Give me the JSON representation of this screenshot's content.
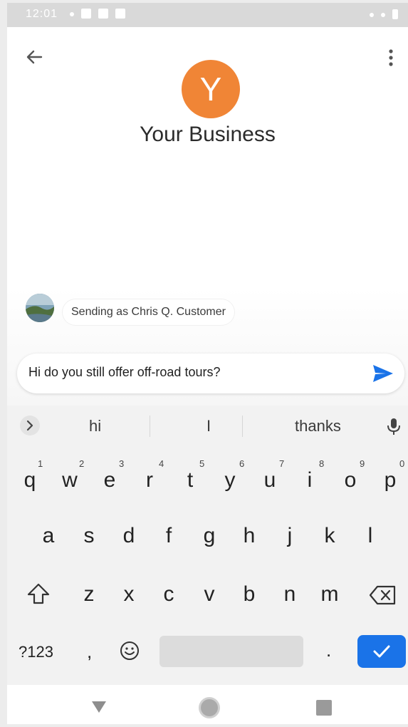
{
  "status_bar": {
    "time": "12:01"
  },
  "header": {
    "business_initial": "Y",
    "business_name": "Your Business",
    "avatar_color": "#f08536"
  },
  "chat": {
    "sending_as": "Sending as Chris Q. Customer"
  },
  "composer": {
    "message_text": "Hi do you still offer off-road tours?",
    "send_color": "#1a73e8"
  },
  "keyboard": {
    "suggestions": [
      "hi",
      "I",
      "thanks"
    ],
    "row1": [
      {
        "letter": "q",
        "num": "1"
      },
      {
        "letter": "w",
        "num": "2"
      },
      {
        "letter": "e",
        "num": "3"
      },
      {
        "letter": "r",
        "num": "4"
      },
      {
        "letter": "t",
        "num": "5"
      },
      {
        "letter": "y",
        "num": "6"
      },
      {
        "letter": "u",
        "num": "7"
      },
      {
        "letter": "i",
        "num": "8"
      },
      {
        "letter": "o",
        "num": "9"
      },
      {
        "letter": "p",
        "num": "0"
      }
    ],
    "row2": [
      "a",
      "s",
      "d",
      "f",
      "g",
      "h",
      "j",
      "k",
      "l"
    ],
    "row3": [
      "z",
      "x",
      "c",
      "v",
      "b",
      "n",
      "m"
    ],
    "symbols_label": "?123",
    "comma": ",",
    "period": ".",
    "enter_color": "#1a73e8"
  }
}
